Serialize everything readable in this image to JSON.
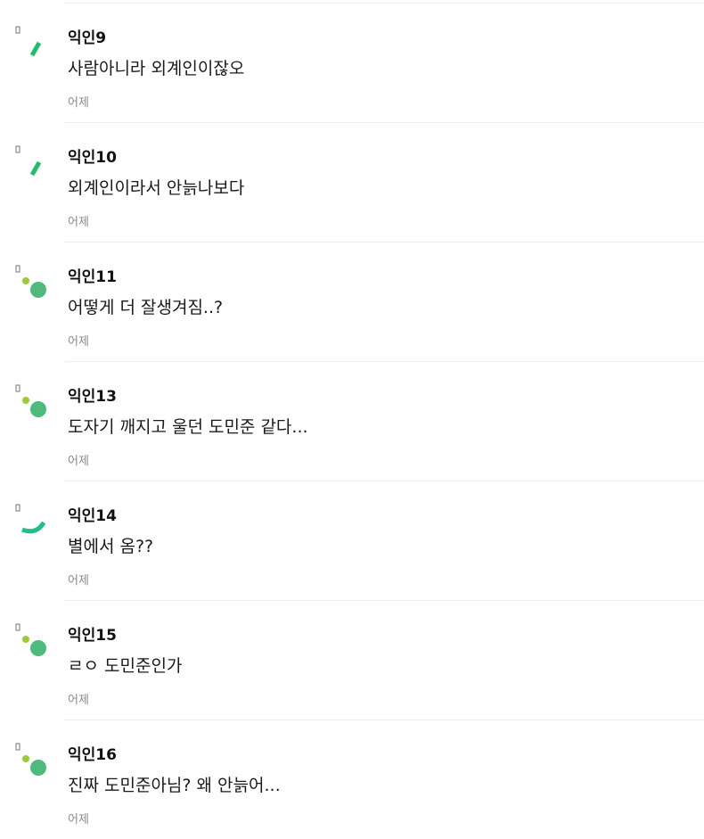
{
  "comments": [
    {
      "author": "익인9",
      "text": "사람아니라 외계인이잖오",
      "time": "어제",
      "avatar": "slash",
      "avatar_color": "#1fbf6a"
    },
    {
      "author": "익인10",
      "text": "외계인이라서 안늙나보다",
      "time": "어제",
      "avatar": "slash",
      "avatar_color": "#1fbf6a"
    },
    {
      "author": "익인11",
      "text": "어떻게 더 잘생겨짐..?",
      "time": "어제",
      "avatar": "dots",
      "avatar_color": "#4dbb7b"
    },
    {
      "author": "익인13",
      "text": "도자기 깨지고 울던 도민준 같다...",
      "time": "어제",
      "avatar": "dots",
      "avatar_color": "#4dbb7b"
    },
    {
      "author": "익인14",
      "text": "별에서 옴??",
      "time": "어제",
      "avatar": "arc",
      "avatar_color": "#1fbf8a"
    },
    {
      "author": "익인15",
      "text": "ㄹㅇ 도민준인가",
      "time": "어제",
      "avatar": "dots",
      "avatar_color": "#4dbb7b"
    },
    {
      "author": "익인16",
      "text": "진짜 도민준아님? 왜 안늙어...",
      "time": "어제",
      "avatar": "dots",
      "avatar_color": "#4dbb7b"
    }
  ]
}
